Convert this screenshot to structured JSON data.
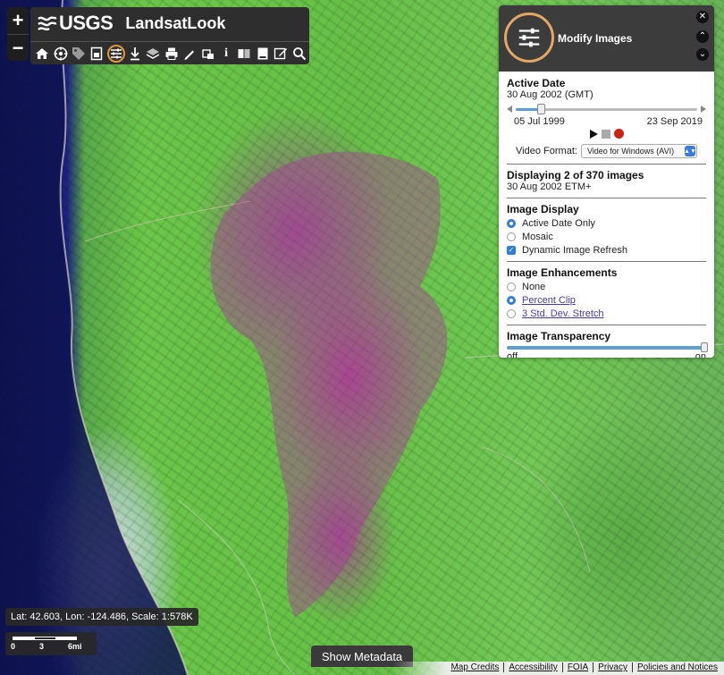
{
  "header": {
    "logo_text": "USGS",
    "app_title": "LandsatLook",
    "zoom_in_label": "+",
    "zoom_out_label": "−",
    "info_label": "i"
  },
  "toolbar": {
    "tools": [
      "home-icon",
      "target-icon",
      "tag-icon",
      "document-icon",
      "sliders-icon",
      "download-icon",
      "layers-icon",
      "print-icon",
      "pencil-icon",
      "location-icon",
      "info-icon",
      "compare-icon",
      "book-icon",
      "edit-icon",
      "search-icon"
    ],
    "active_tool": "sliders-icon",
    "active_color": "#e09a3a"
  },
  "panel": {
    "title": "Modify Images",
    "close_label": "✕",
    "up_label": "⌃",
    "down_label": "⌄",
    "active_date": {
      "heading": "Active Date",
      "value": "30 Aug 2002 (GMT)",
      "start": "05 Jul 1999",
      "end": "23 Sep 2019",
      "position_fraction": 0.14
    },
    "video_format": {
      "label": "Video Format:",
      "selected": "Video for Windows (AVI)"
    },
    "displaying": {
      "heading": "Displaying 2 of 370 images",
      "detail": "30 Aug 2002 ETM+"
    },
    "image_display": {
      "heading": "Image Display",
      "options": [
        {
          "label": "Active Date Only",
          "selected": true
        },
        {
          "label": "Mosaic",
          "selected": false
        }
      ],
      "checkbox": {
        "label": "Dynamic Image Refresh",
        "checked": true
      }
    },
    "enhancements": {
      "heading": "Image Enhancements",
      "options": [
        {
          "label": "None",
          "selected": false
        },
        {
          "label": "Percent Clip",
          "selected": true
        },
        {
          "label": "3 Std. Dev. Stretch",
          "selected": false
        }
      ]
    },
    "transparency": {
      "heading": "Image Transparency",
      "off_label": "off",
      "on_label": "on",
      "value_fraction": 1.0
    },
    "accent_color": "#e4a663",
    "slider_color": "#5b9fd5"
  },
  "status": {
    "coords": "Lat: 42.603, Lon: -124.486, Scale: 1:578K",
    "scale_labels": [
      "0",
      "3",
      "6mi"
    ]
  },
  "metadata_button": "Show Metadata",
  "footer": {
    "links": [
      "Map Credits",
      "Accessibility",
      "FOIA",
      "Privacy",
      "Policies and Notices"
    ]
  }
}
